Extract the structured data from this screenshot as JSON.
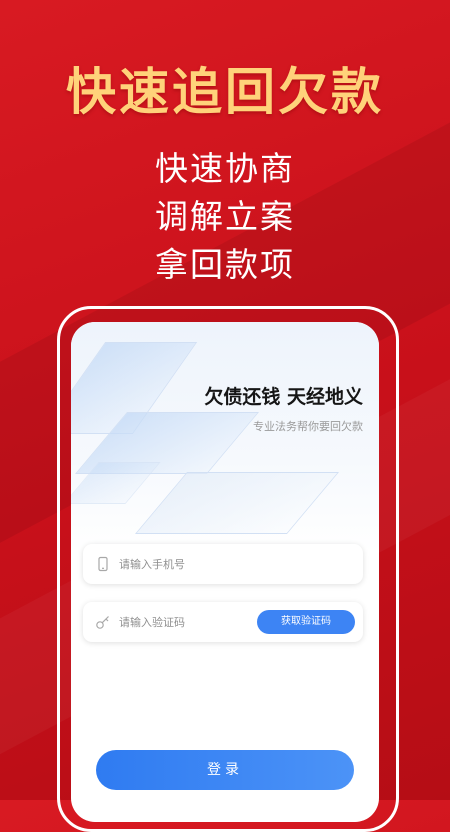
{
  "banner": {
    "headline": "快速追回欠款",
    "lines": [
      "快速协商",
      "调解立案",
      "拿回款项"
    ]
  },
  "screen": {
    "slogan": "欠债还钱 天经地义",
    "tagline": "专业法务帮你要回欠款",
    "phone_field": {
      "placeholder": "请输入手机号",
      "icon": "phone-icon"
    },
    "code_field": {
      "placeholder": "请输入验证码",
      "icon": "key-icon"
    },
    "get_code_button": "获取验证码",
    "login_button": "登录"
  },
  "colors": {
    "background": "#d01820",
    "headline": "#ffd27a",
    "accent": "#3d84f4"
  }
}
